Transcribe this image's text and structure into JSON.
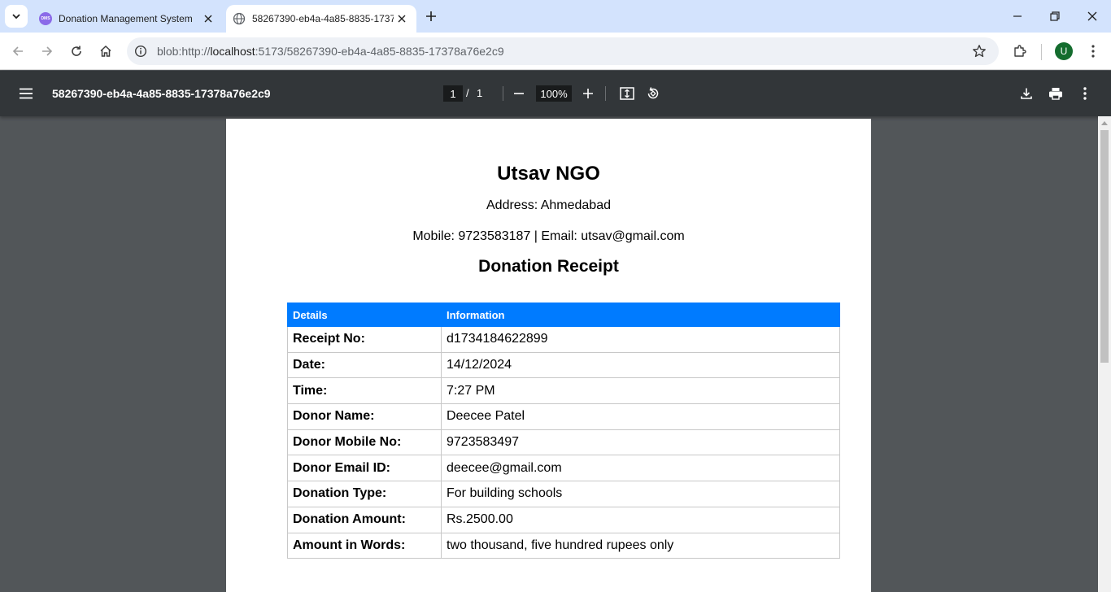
{
  "browser": {
    "tabs": [
      {
        "title": "Donation Management System",
        "favicon_text": "DMS",
        "active": false
      },
      {
        "title": "58267390-eb4a-4a85-8835-17378a76e2c9",
        "active": true
      }
    ],
    "url": {
      "scheme": "blob:http://",
      "host": "localhost",
      "rest": ":5173/58267390-eb4a-4a85-8835-17378a76e2c9"
    },
    "profile_initial": "U",
    "icons": [
      "tab-search-icon",
      "close-icon",
      "new-tab-icon",
      "minimize-icon",
      "restore-icon",
      "window-close-icon",
      "back-icon",
      "forward-icon",
      "reload-icon",
      "home-icon",
      "site-info-icon",
      "bookmark-star-icon",
      "extensions-icon",
      "more-vert-icon"
    ]
  },
  "pdf_viewer": {
    "title": "58267390-eb4a-4a85-8835-17378a76e2c9",
    "current_page": "1",
    "page_separator": "/",
    "total_pages": "1",
    "zoom": "100%",
    "icons": [
      "menu-icon",
      "zoom-out-icon",
      "zoom-in-icon",
      "fit-page-icon",
      "rotate-icon",
      "download-icon",
      "print-icon",
      "more-vert-icon"
    ]
  },
  "receipt": {
    "org_name": "Utsav NGO",
    "address": "Address: Ahmedabad",
    "contact": "Mobile: 9723583187 | Email: utsav@gmail.com",
    "title": "Donation Receipt",
    "headers": [
      "Details",
      "Information"
    ],
    "rows": [
      {
        "label": "Receipt No:",
        "value": "d1734184622899"
      },
      {
        "label": "Date:",
        "value": "14/12/2024"
      },
      {
        "label": "Time:",
        "value": "7:27 PM"
      },
      {
        "label": "Donor Name:",
        "value": "Deecee Patel"
      },
      {
        "label": "Donor Mobile No:",
        "value": "9723583497"
      },
      {
        "label": "Donor Email ID:",
        "value": "deecee@gmail.com"
      },
      {
        "label": "Donation Type:",
        "value": "For building schools"
      },
      {
        "label": "Donation Amount:",
        "value": "Rs.2500.00"
      },
      {
        "label": "Amount in Words:",
        "value": "two thousand, five hundred rupees only"
      }
    ]
  },
  "colors": {
    "tabstrip": "#d3e3fd",
    "pdf_toolbar": "#323639",
    "pdf_background": "#525659",
    "table_header": "#007bff",
    "avatar": "#146c2e"
  }
}
